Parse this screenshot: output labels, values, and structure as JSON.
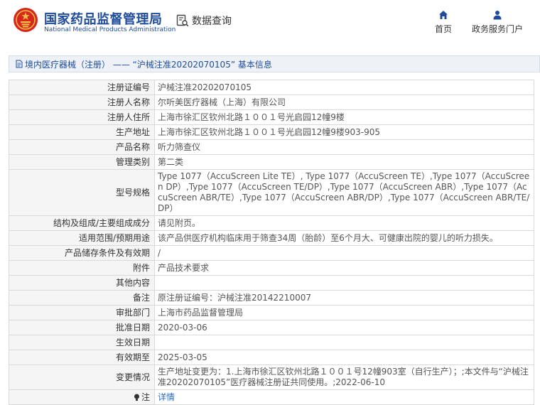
{
  "header": {
    "site_name_cn": "国家药品监督管理局",
    "site_name_en": "National Medical Products Administration",
    "search_label": "数据查询",
    "nav": [
      {
        "label": "首页",
        "icon": "home-icon"
      },
      {
        "label": "政务服务门户",
        "icon": "user-icon"
      }
    ],
    "brand_color": "#1f4c9a"
  },
  "breadcrumb": {
    "text": "境内医疗器械（注册） —— “沪械注准20202070105” 基本信息"
  },
  "details": [
    {
      "label": "注册证编号",
      "value": "沪械注准20202070105"
    },
    {
      "label": "注册人名称",
      "value": "尔听美医疗器械（上海）有限公司"
    },
    {
      "label": "注册人住所",
      "value": "上海市徐汇区钦州北路１００１号光启园12幢9楼"
    },
    {
      "label": "生产地址",
      "value": "上海市徐汇区钦州北路１００１号光启园12幢9楼903-905"
    },
    {
      "label": "产品名称",
      "value": "听力筛查仪"
    },
    {
      "label": "管理类别",
      "value": "第二类"
    },
    {
      "label": "型号规格",
      "value": "Type 1077（AccuScreen Lite TE）, Type 1077（AccuScreen TE）,Type 1077（AccuScreen DP）,Type 1077（AccuScreen TE/DP）,Type 1077（AccuScreen ABR）,Type 1077（AccuScreen ABR/TE）,Type 1077（AccuScreen ABR/DP）,Type 1077（AccuScreen ABR/TE/DP）"
    },
    {
      "label": "结构及组成/主要组成成分",
      "value": "请见附页。"
    },
    {
      "label": "适用范围/预期用途",
      "value": "该产品供医疗机构临床用于筛查34周（胎龄）至6个月大、可健康出院的婴儿的听力损失。"
    },
    {
      "label": "产品储存条件及有效期",
      "value": "/"
    },
    {
      "label": "附件",
      "value": "产品技术要求"
    },
    {
      "label": "其他内容",
      "value": ""
    },
    {
      "label": "备注",
      "value": "原注册证编号：沪械注准20142210007"
    },
    {
      "label": "审批部门",
      "value": "上海市药品监督管理局"
    },
    {
      "label": "批准日期",
      "value": "2020-03-06"
    },
    {
      "label": "生效日期",
      "value": ""
    },
    {
      "label": "有效期至",
      "value": "2025-03-05"
    },
    {
      "label": "变更情况",
      "value": "生产地址变更为：1.上海市徐汇区钦州北路１００１号12幢903室（自行生产）；;本文件与“沪械注准20202070105”医疗器械注册证共同使用。;2022-06-10"
    }
  ],
  "note": {
    "label": "注",
    "link": "详情",
    "link_color": "#2a6ec1"
  }
}
